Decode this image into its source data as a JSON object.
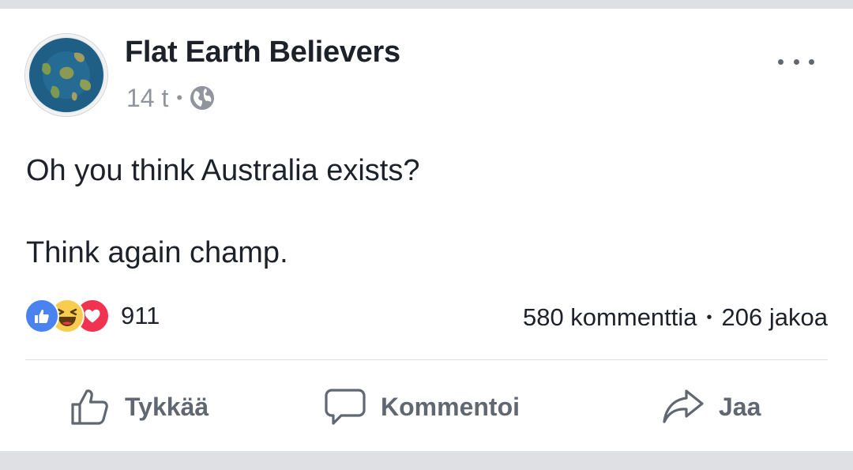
{
  "post": {
    "page_name": "Flat Earth Believers",
    "time": "14 t",
    "separator": "•",
    "audience_icon": "globe-icon",
    "more_icon": "more-options-icon",
    "text_lines": [
      "Oh you think Australia exists?",
      "Think again champ."
    ]
  },
  "engagement": {
    "reactions": [
      "like-reaction-icon",
      "haha-reaction-icon",
      "love-reaction-icon"
    ],
    "reaction_count": "911",
    "comments": "580 kommenttia",
    "separator": "•",
    "shares": "206 jakoa"
  },
  "actions": {
    "like": {
      "label": "Tykkää",
      "icon": "thumbs-up-icon"
    },
    "comment": {
      "label": "Kommentoi",
      "icon": "comment-bubble-icon"
    },
    "share": {
      "label": "Jaa",
      "icon": "share-arrow-icon"
    }
  },
  "colors": {
    "like_blue": "#4a82f0",
    "haha_yellow": "#f7cc4f",
    "love_red": "#f0334f",
    "muted_text": "#90949c",
    "action_text": "#606770"
  }
}
